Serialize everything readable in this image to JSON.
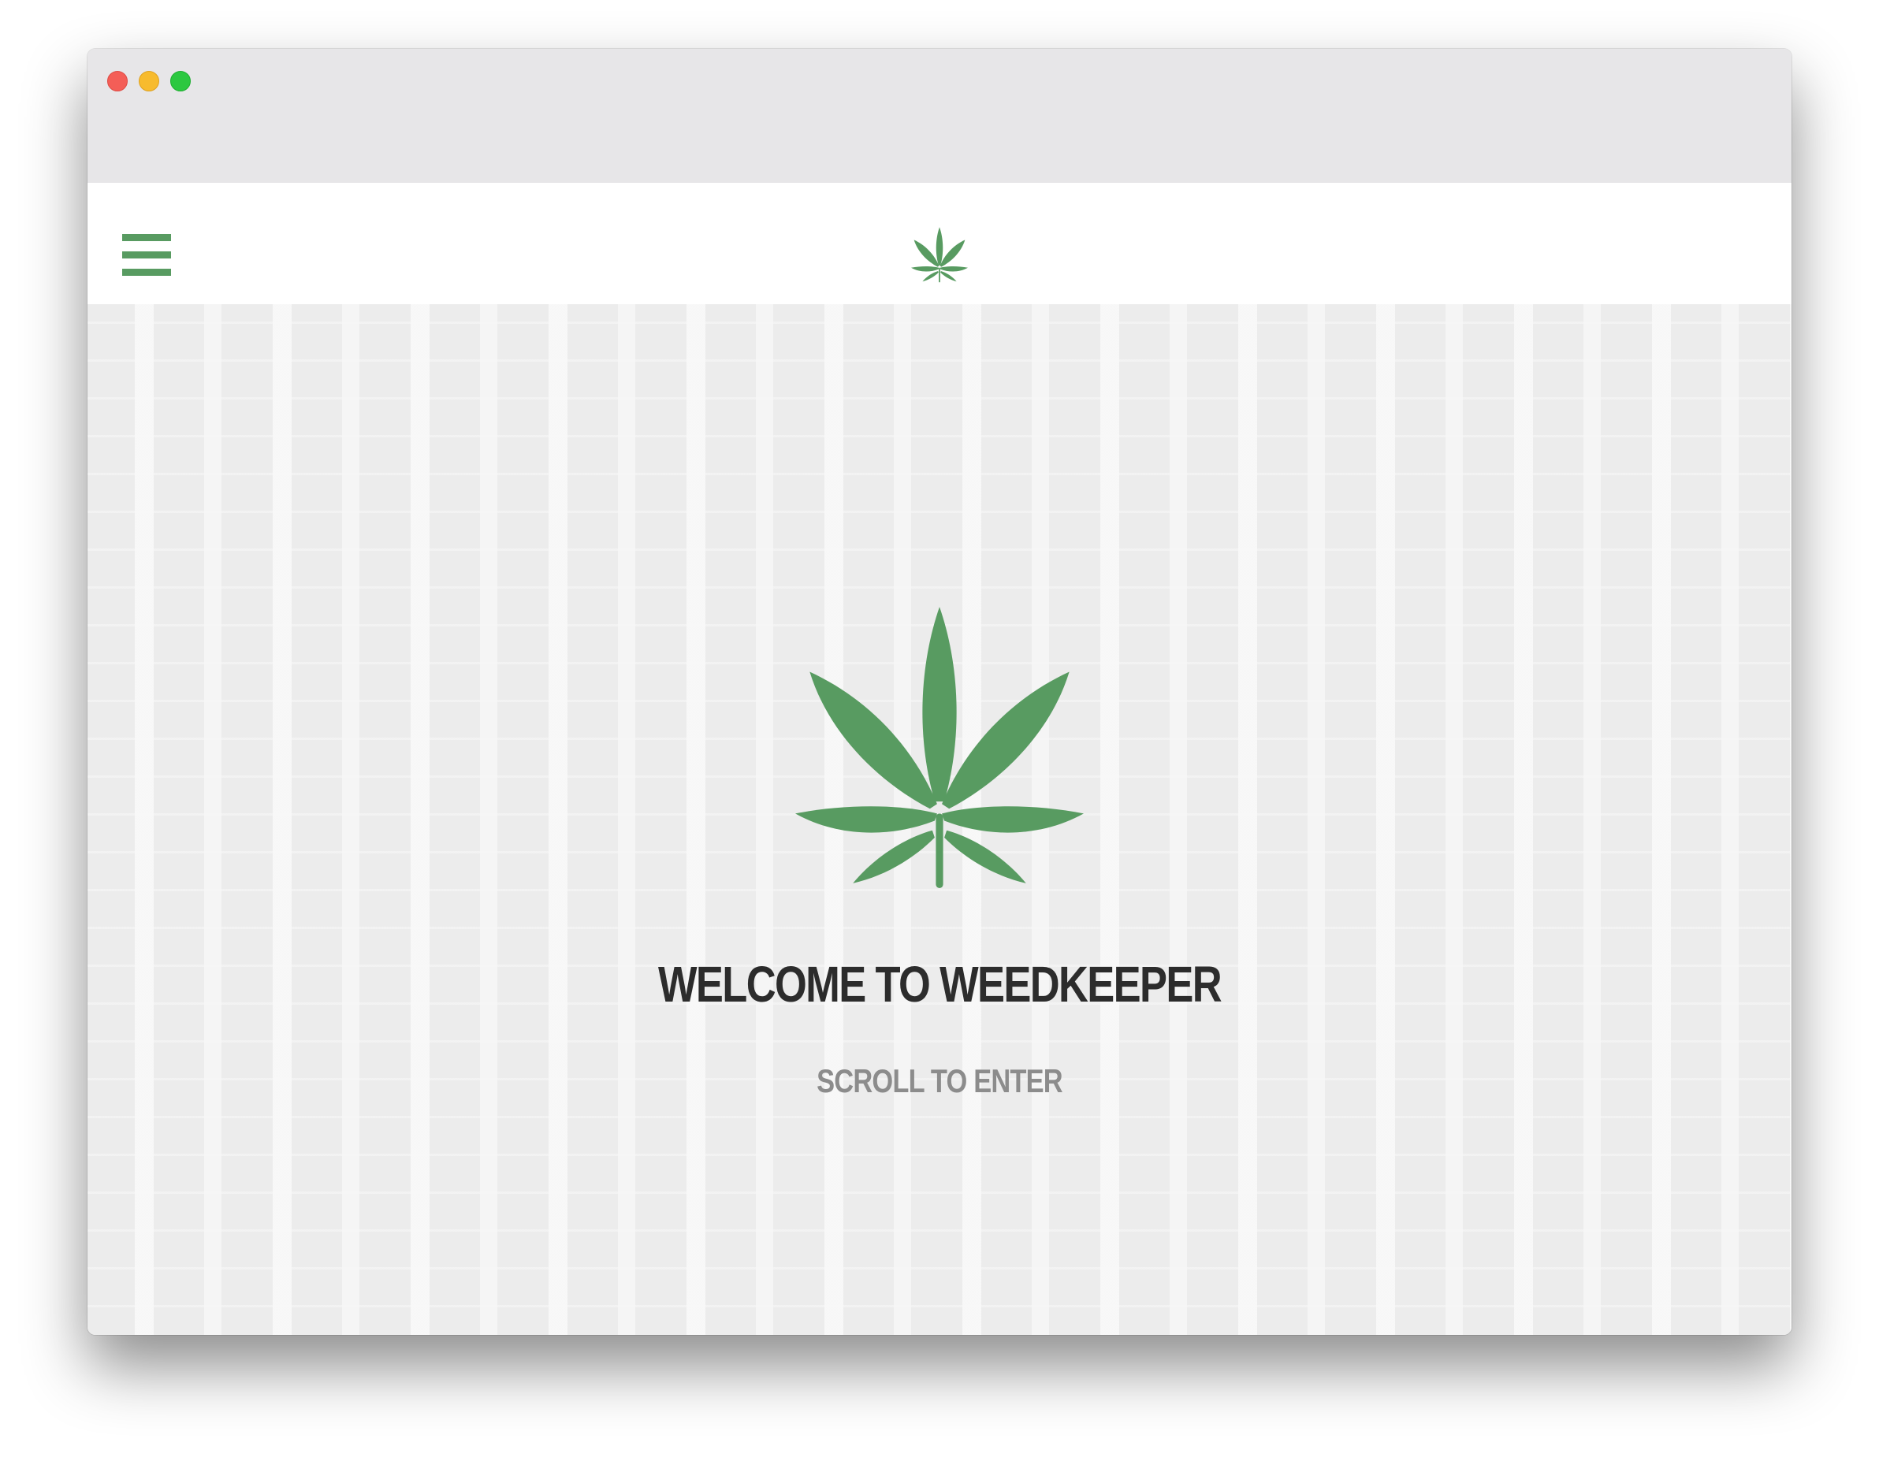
{
  "window": {
    "controls": [
      "close",
      "minimize",
      "maximize"
    ]
  },
  "navbar": {
    "menu_icon": "hamburger-menu-icon",
    "logo_icon": "cannabis-leaf-icon"
  },
  "hero": {
    "logo_icon": "cannabis-leaf-icon",
    "title": "WELCOME TO WEEDKEEPER",
    "subtitle": "SCROLL TO ENTER"
  },
  "colors": {
    "accent": "#589b61",
    "title": "#2c2c2c",
    "subtitle": "#8c8c8c",
    "hero_background": "#ececec",
    "titlebar": "#e7e6e8"
  }
}
